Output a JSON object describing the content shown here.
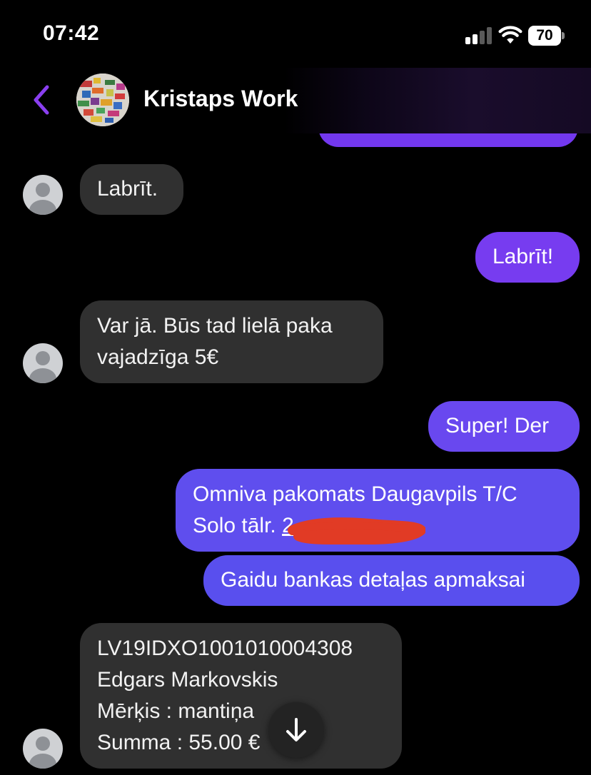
{
  "status_bar": {
    "time": "07:42",
    "battery": "70",
    "icons": [
      "cellular-signal-icon",
      "wifi-icon",
      "battery-icon"
    ]
  },
  "header": {
    "title": "Kristaps Work",
    "back_icon": "chevron-left-icon",
    "accent_color": "#8a3ff0"
  },
  "colors": {
    "incoming_bubble": "#303030",
    "outgoing_top": "#7a3bf0",
    "outgoing_bottom": "#5b50ee",
    "redaction": "#e13b25"
  },
  "messages": [
    {
      "direction": "incoming",
      "lines": [
        "Labrīt."
      ]
    },
    {
      "direction": "outgoing",
      "lines": [
        "Labrīt!"
      ]
    },
    {
      "direction": "incoming",
      "lines": [
        "Var jā. Būs tad lielā paka",
        "vajadzīga 5€"
      ]
    },
    {
      "direction": "outgoing",
      "lines": [
        "Super! Der"
      ]
    },
    {
      "direction": "outgoing",
      "lines": [
        "Omniva pakomats Daugavpils T/C",
        "Solo tālr."
      ],
      "phone_visible": "2",
      "phone_redacted": true
    },
    {
      "direction": "outgoing",
      "lines": [
        "Gaidu bankas detaļas apmaksai"
      ]
    },
    {
      "direction": "incoming",
      "lines": [
        "LV19IDXO1001010004308",
        "Edgars Markovskis",
        "Mērķis : mantiņa",
        "Summa : 55.00 €"
      ]
    }
  ],
  "scroll_button": {
    "icon": "arrow-down-icon"
  }
}
